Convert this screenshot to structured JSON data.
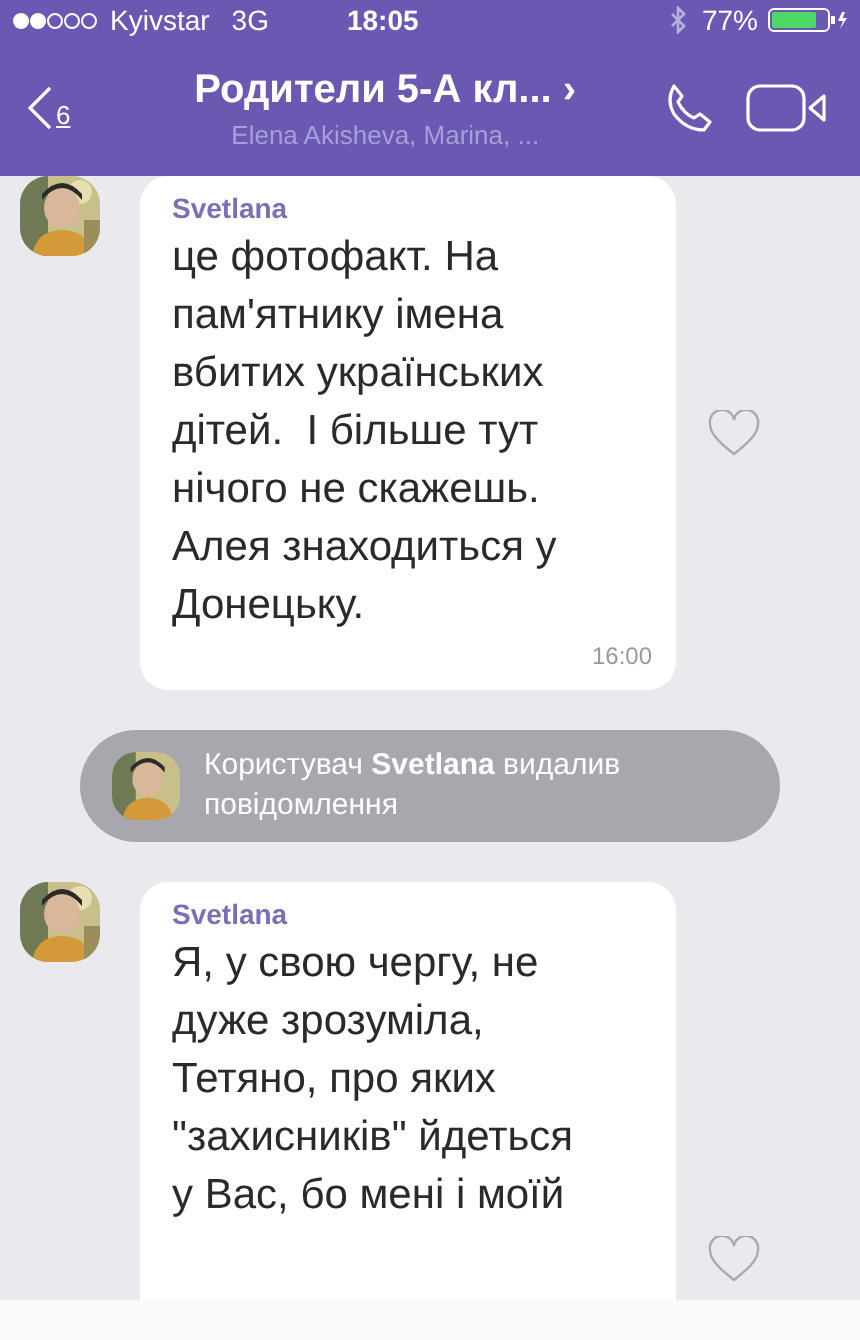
{
  "status_bar": {
    "carrier": "Kyivstar",
    "network": "3G",
    "time": "18:05",
    "battery": "77%"
  },
  "header": {
    "back_count": "6",
    "title": "Родители 5-А кл... ›",
    "subtitle": "Elena Akisheva, Marina, ..."
  },
  "messages": [
    {
      "kind": "message",
      "sender": "Svetlana",
      "lines": [
        "це фотофакт. На",
        "пам'ятнику імена",
        "вбитих українських",
        "дітей.  І більше тут",
        "нічого не скажешь.",
        "Алея знаходиться у",
        "Донецьку."
      ],
      "time": "16:00"
    },
    {
      "kind": "system",
      "text": "Користувач **Svetlana** видалив повідомлення"
    },
    {
      "kind": "message",
      "sender": "Svetlana",
      "lines": [
        "Я, у свою чергу, не",
        "дуже зрозуміла,",
        "Тетяно, про яких",
        "\"захисників\" йдеться",
        "у Вас, бо мені і моїй"
      ]
    }
  ]
}
